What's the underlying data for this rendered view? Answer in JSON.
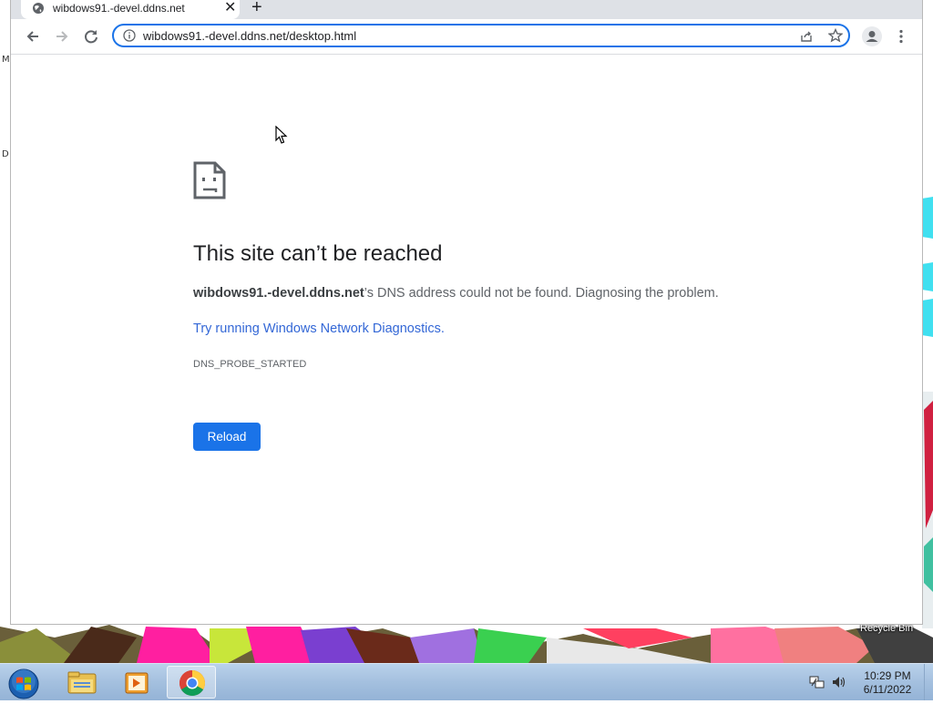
{
  "browser": {
    "tab": {
      "title": "wibdows91.-devel.ddns.net",
      "close_glyph": "✕"
    },
    "new_tab_glyph": "+",
    "omnibox": {
      "url": "wibdows91.-devel.ddns.net/desktop.html"
    }
  },
  "error_page": {
    "title": "This site can’t be reached",
    "host": "wibdows91.-devel.ddns.net",
    "message": "’s DNS address could not be found. Diagnosing the problem.",
    "suggestion_link": "Try running Windows Network Diagnostics.",
    "error_code": "DNS_PROBE_STARTED",
    "reload_label": "Reload"
  },
  "desktop": {
    "fragment_top": "M",
    "fragment_mid": "D",
    "recycle_bin_label": "Recycle Bin"
  },
  "taskbar": {
    "pinned": [
      "windows-explorer-icon",
      "media-player-icon",
      "chrome-icon"
    ],
    "clock_time": "10:29 PM",
    "clock_date": "6/11/2022"
  },
  "colors": {
    "accent": "#1a73e8",
    "link": "#3367d6",
    "taskbar": "#a4c0df"
  }
}
